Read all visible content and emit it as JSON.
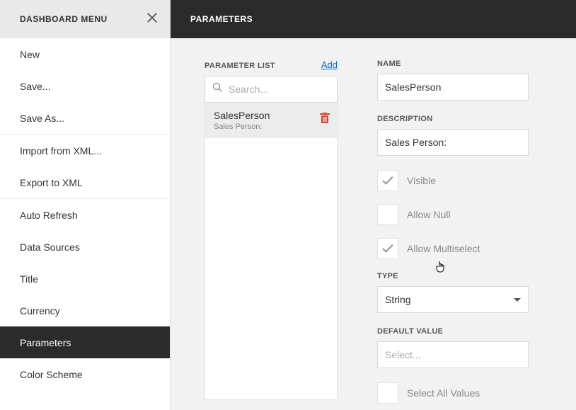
{
  "sidebar": {
    "title": "DASHBOARD MENU",
    "items": [
      {
        "label": "New"
      },
      {
        "label": "Save..."
      },
      {
        "label": "Save As..."
      },
      {
        "label": "Import from XML..."
      },
      {
        "label": "Export to XML"
      },
      {
        "label": "Auto Refresh"
      },
      {
        "label": "Data Sources"
      },
      {
        "label": "Title"
      },
      {
        "label": "Currency"
      },
      {
        "label": "Parameters"
      },
      {
        "label": "Color Scheme"
      }
    ]
  },
  "header": {
    "title": "PARAMETERS"
  },
  "paramList": {
    "title": "PARAMETER LIST",
    "addLabel": "Add",
    "searchPlaceholder": "Search...",
    "items": [
      {
        "name": "SalesPerson",
        "desc": "Sales Person:"
      }
    ]
  },
  "form": {
    "nameLabel": "NAME",
    "nameValue": "SalesPerson",
    "descLabel": "DESCRIPTION",
    "descValue": "Sales Person:",
    "visibleLabel": "Visible",
    "allowNullLabel": "Allow Null",
    "allowMultiLabel": "Allow Multiselect",
    "typeLabel": "TYPE",
    "typeValue": "String",
    "defaultLabel": "DEFAULT VALUE",
    "defaultPlaceholder": "Select...",
    "selectAllLabel": "Select All Values"
  }
}
